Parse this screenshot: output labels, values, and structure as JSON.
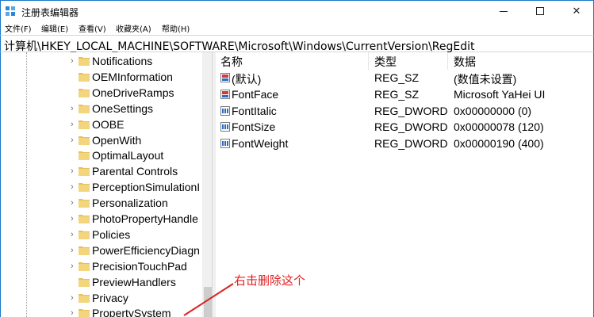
{
  "window": {
    "title": "注册表编辑器",
    "accent_color": "#1979ca",
    "controls": {
      "minimize_icon": "minimize-icon",
      "maximize_icon": "maximize-icon",
      "close_icon": "close-icon",
      "close_glyph": "✕"
    }
  },
  "menu": {
    "items": [
      {
        "label": "文件(F)"
      },
      {
        "label": "编辑(E)"
      },
      {
        "label": "查看(V)"
      },
      {
        "label": "收藏夹(A)"
      },
      {
        "label": "帮助(H)"
      }
    ]
  },
  "address": {
    "path": "计算机\\HKEY_LOCAL_MACHINE\\SOFTWARE\\Microsoft\\Windows\\CurrentVersion\\RegEdit"
  },
  "tree": {
    "items": [
      {
        "label": "Notifications",
        "expandable": true
      },
      {
        "label": "OEMInformation",
        "expandable": false
      },
      {
        "label": "OneDriveRamps",
        "expandable": false
      },
      {
        "label": "OneSettings",
        "expandable": true
      },
      {
        "label": "OOBE",
        "expandable": true
      },
      {
        "label": "OpenWith",
        "expandable": true
      },
      {
        "label": "OptimalLayout",
        "expandable": false
      },
      {
        "label": "Parental Controls",
        "expandable": true
      },
      {
        "label": "PerceptionSimulationI",
        "expandable": true
      },
      {
        "label": "Personalization",
        "expandable": true
      },
      {
        "label": "PhotoPropertyHandle",
        "expandable": true
      },
      {
        "label": "Policies",
        "expandable": true
      },
      {
        "label": "PowerEfficiencyDiagn",
        "expandable": true
      },
      {
        "label": "PrecisionTouchPad",
        "expandable": true
      },
      {
        "label": "PreviewHandlers",
        "expandable": false
      },
      {
        "label": "Privacy",
        "expandable": true
      },
      {
        "label": "PropertySystem",
        "expandable": true
      }
    ],
    "arrow_glyph": "›",
    "folder_color": "#e8c05a"
  },
  "list": {
    "columns": {
      "name": "名称",
      "type": "类型",
      "data": "数据"
    },
    "rows": [
      {
        "name": "(默认)",
        "type": "REG_SZ",
        "data": "(数值未设置)",
        "icon": "string-value-icon"
      },
      {
        "name": "FontFace",
        "type": "REG_SZ",
        "data": "Microsoft YaHei UI",
        "icon": "string-value-icon"
      },
      {
        "name": "FontItalic",
        "type": "REG_DWORD",
        "data": "0x00000000 (0)",
        "icon": "binary-value-icon"
      },
      {
        "name": "FontSize",
        "type": "REG_DWORD",
        "data": "0x00000078 (120)",
        "icon": "binary-value-icon"
      },
      {
        "name": "FontWeight",
        "type": "REG_DWORD",
        "data": "0x00000190 (400)",
        "icon": "binary-value-icon"
      }
    ]
  },
  "annotation": {
    "text": "右击删除这个",
    "color": "#e02020"
  }
}
